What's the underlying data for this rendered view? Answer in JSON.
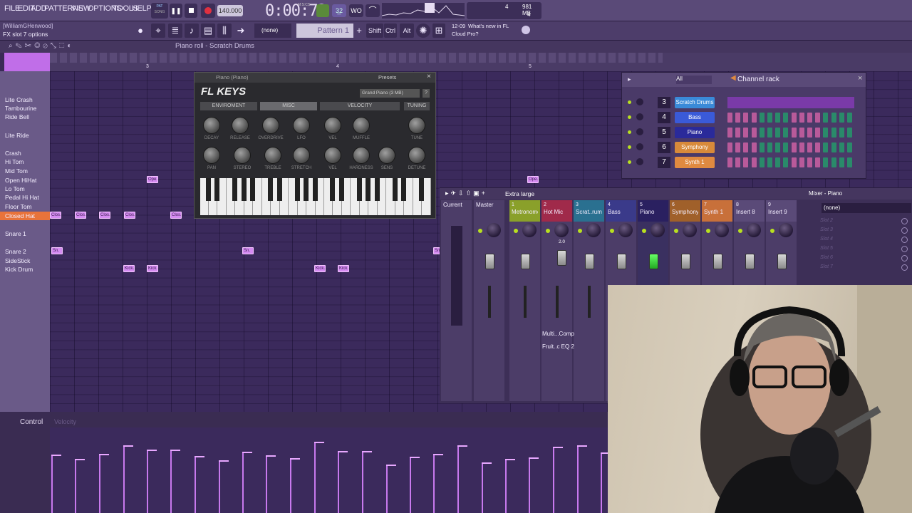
{
  "menu": {
    "items": [
      "FILE",
      "EDIT",
      "ADD",
      "PATTERNS",
      "VIEW",
      "OPTIONS",
      "TOOLS",
      "HELP"
    ]
  },
  "transport": {
    "mode_pat": "PAT",
    "mode_song": "SONG",
    "tempo": "140.000",
    "time": "0:00:72",
    "time_label": "M:S:CS"
  },
  "monitor": {
    "cpu": "4",
    "ram": "981 MB",
    "voices": "4"
  },
  "user": {
    "name": "[WilliamGHenwood]",
    "hint": "FX slot 7 options"
  },
  "toolbar2": {
    "channel_select": "(none)",
    "pattern": "Pattern 1",
    "shift": "Shift",
    "ctrl": "Ctrl",
    "alt": "Alt",
    "news_date": "12-09",
    "news_title": "What's new in FL",
    "news_sub": "Cloud Pro?"
  },
  "pianoroll": {
    "title": "Piano roll - Scratch Drums",
    "bar_numbers": [
      "3",
      "4",
      "5"
    ],
    "keys": [
      "Lite Crash",
      "Tambourine",
      "Ride Bell",
      "Lite Ride",
      "Crash",
      "Hi Tom",
      "Mid Tom",
      "Open HiHat",
      "Lo Tom",
      "Pedal Hi Hat",
      "Floor Tom",
      "Closed Hat",
      "Snare 1",
      "Snare 2",
      "SideStick",
      "Kick Drum"
    ],
    "selected_key": "Closed Hat",
    "note_labels": {
      "open": "Ope.",
      "closed": "Clos.",
      "snare": "Sn.",
      "kick": "Kick."
    }
  },
  "control": {
    "label": "Control",
    "target": "Velocity"
  },
  "flkeys": {
    "window_title": "Piano (Piano)",
    "presets": "Presets",
    "title": "FL KEYS",
    "preset": "Grand Piano (3 MB)",
    "help": "?",
    "tabs": [
      "ENVIROMENT",
      "MISC",
      "VELOCITY",
      "TUNING"
    ],
    "knobs_row1": [
      "DECAY",
      "RELEASE",
      "OVERDRIVE",
      "LFO",
      "VEL",
      "MUFFLE",
      "TUNE"
    ],
    "knobs_row2": [
      "PAN",
      "STEREO",
      "TREBLE",
      "STRETCH",
      "VEL",
      "HARDNESS",
      "SENS",
      "DETUNE"
    ]
  },
  "channelrack": {
    "filter": "All",
    "title": "Channel rack",
    "channels": [
      {
        "num": "3",
        "name": "Scratch Drums",
        "color": "#3a8ad8"
      },
      {
        "num": "4",
        "name": "Bass",
        "color": "#3a5ad8"
      },
      {
        "num": "5",
        "name": "Piano",
        "color": "#2a2a9a"
      },
      {
        "num": "6",
        "name": "Symphony",
        "color": "#d88a3a"
      },
      {
        "num": "7",
        "name": "Synth 1",
        "color": "#e08a40"
      }
    ]
  },
  "mixer": {
    "size_label": "Extra large",
    "title": "Mixer - Piano",
    "slot_select": "(none)",
    "tracks": [
      {
        "num": "",
        "name": "Current",
        "color": "#4c3d68"
      },
      {
        "num": "",
        "name": "Master",
        "color": "#4c3d68"
      },
      {
        "num": "1",
        "name": "Metronome",
        "color": "#8aa02a"
      },
      {
        "num": "2",
        "name": "Hot Mic",
        "color": "#a02a4a"
      },
      {
        "num": "3",
        "name": "Scrat..rums",
        "color": "#2a7090"
      },
      {
        "num": "4",
        "name": "Bass",
        "color": "#3a3a8a"
      },
      {
        "num": "5",
        "name": "Piano",
        "color": "#2a2060"
      },
      {
        "num": "6",
        "name": "Symphony",
        "color": "#a0602a"
      },
      {
        "num": "7",
        "name": "Synth 1",
        "color": "#c8703a"
      },
      {
        "num": "8",
        "name": "Insert 8",
        "color": "#5a4a78"
      },
      {
        "num": "9",
        "name": "Insert 9",
        "color": "#5a4a78"
      }
    ],
    "fx_hot_mic": [
      "Multi...Comp",
      "Fruit..c EQ 2"
    ],
    "hotmic_value": "2.0",
    "slots": [
      "Slot 2",
      "Slot 3",
      "Slot 4",
      "Slot 5",
      "Slot 6",
      "Slot 7"
    ]
  }
}
